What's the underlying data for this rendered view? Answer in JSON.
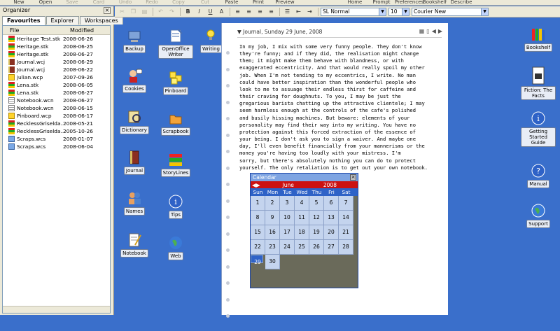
{
  "topbar": {
    "items": [
      {
        "label": "New",
        "enabled": true
      },
      {
        "label": "Open",
        "enabled": true
      },
      {
        "label": "Save",
        "enabled": false
      },
      {
        "label": "Card",
        "enabled": false
      },
      {
        "label": "Undo",
        "enabled": false
      },
      {
        "label": "Redo",
        "enabled": false
      },
      {
        "label": "Copy",
        "enabled": false
      },
      {
        "label": "Cut",
        "enabled": false
      },
      {
        "label": "Paste",
        "enabled": true
      },
      {
        "label": "Print",
        "enabled": true
      },
      {
        "label": "Preview",
        "enabled": true
      },
      {
        "label": "Home",
        "enabled": true
      },
      {
        "label": "Prompt",
        "enabled": true
      },
      {
        "label": "Preferences",
        "enabled": true
      },
      {
        "label": "Bookshelf",
        "enabled": true
      },
      {
        "label": "Describe",
        "enabled": true
      }
    ]
  },
  "organizer": {
    "title": "Organizer",
    "tabs": [
      "Favourites",
      "Explorer",
      "Workspaces"
    ],
    "columns": [
      "File",
      "Modified"
    ],
    "files": [
      {
        "name": "Heritage Test.stk",
        "date": "2008-06-26",
        "type": "stk"
      },
      {
        "name": "Heritage.stk",
        "date": "2008-06-25",
        "type": "stk"
      },
      {
        "name": "Heritage.stk",
        "date": "2008-06-27",
        "type": "stk"
      },
      {
        "name": "Journal.wcj",
        "date": "2008-06-29",
        "type": "wcj"
      },
      {
        "name": "Journal.wcj",
        "date": "2008-06-22",
        "type": "wcj"
      },
      {
        "name": "julian.wcp",
        "date": "2007-09-26",
        "type": "wcp"
      },
      {
        "name": "Lena.stk",
        "date": "2008-06-05",
        "type": "stk"
      },
      {
        "name": "Lena.stk",
        "date": "2008-06-27",
        "type": "stk"
      },
      {
        "name": "Notebook.wcn",
        "date": "2008-06-27",
        "type": "wcn"
      },
      {
        "name": "Notebook.wcn",
        "date": "2008-06-15",
        "type": "wcn"
      },
      {
        "name": "Pinboard.wcp",
        "date": "2008-06-17",
        "type": "wcp"
      },
      {
        "name": "RecklessGriselda...",
        "date": "2008-05-21",
        "type": "stk"
      },
      {
        "name": "RecklessGriselda...",
        "date": "2005-10-26",
        "type": "stk"
      },
      {
        "name": "Scraps.wcs",
        "date": "2008-01-07",
        "type": "wcs"
      },
      {
        "name": "Scraps.wcs",
        "date": "2008-06-04",
        "type": "wcs"
      }
    ]
  },
  "format": {
    "style": "SL Normal",
    "size": "10",
    "font": "Courier New"
  },
  "desktop": {
    "col1": [
      "Backup",
      "Cookies",
      "Dictionary",
      "Journal",
      "Names",
      "Notebook"
    ],
    "col2": [
      "OpenOffice Writer",
      "Pinboard",
      "Scrapbook",
      "StoryLines",
      "Tips",
      "Web"
    ],
    "col3": [
      "Writing Prompts"
    ]
  },
  "right_panel": [
    "Bookshelf",
    "Fiction: The Facts",
    "Getting Started Guide",
    "Manual",
    "Support"
  ],
  "journal": {
    "header": "Journal, Sunday 29 June, 2008",
    "text": "In my job, I mix with some very funny people. They don't know\nthey're funny; and if they did, the realisation might change\nthem; it might make them behave with blandness, or with\nexaggerated eccentricity. And that would really spoil my other\njob. When I'm not tending to my eccentrics, I write. No man\ncould have better inspiration than the wonderful people who\nlook to me to assuage their endless thirst for caffeine and\ntheir craving for doughnuts. To you, I may be just the\ngregarious barista chatting up the attractive clientele; I may\nseem harmless enough at the controls of the cafe's polished\nand busily hissing machines. But beware: elements of your\npersonality may find their way into my writing. You have no\nprotection against this forced extraction of the essence of\nyour being. I don't ask you to sign a waiver. And maybe one\nday, I'll even benefit financially from your mannerisms or the\nmoney you're having too loudly with your mistress. I'm\nsorry, but there's absolutely nothing you can do to protect\nyourself. The only retaliation is to get out your own notebook."
  },
  "calendar": {
    "title": "Calendar",
    "month": "June",
    "year": "2008",
    "weekdays": [
      "Sun",
      "Mon",
      "Tue",
      "Wed",
      "Thu",
      "Fri",
      "Sat"
    ],
    "days": [
      "1",
      "2",
      "3",
      "4",
      "5",
      "6",
      "7",
      "8",
      "9",
      "10",
      "11",
      "12",
      "13",
      "14",
      "15",
      "16",
      "17",
      "18",
      "19",
      "20",
      "21",
      "22",
      "23",
      "24",
      "25",
      "26",
      "27",
      "28",
      "29",
      "30"
    ],
    "selected": "29"
  }
}
